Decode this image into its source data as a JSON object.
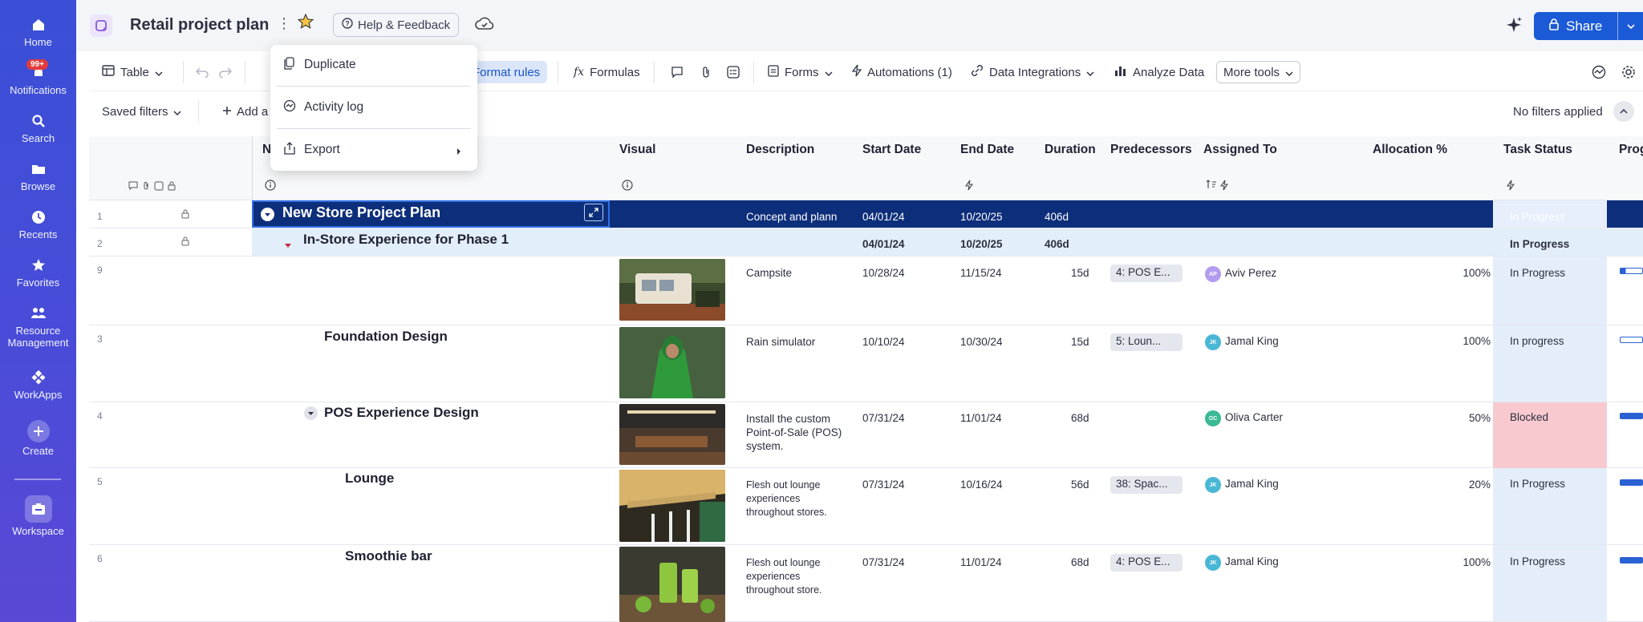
{
  "nav": {
    "items": [
      {
        "label": "Home",
        "icon": "home-icon"
      },
      {
        "label": "Notifications",
        "icon": "bell-icon",
        "badge": "99+"
      },
      {
        "label": "Search",
        "icon": "search-icon"
      },
      {
        "label": "Browse",
        "icon": "folder-icon"
      },
      {
        "label": "Recents",
        "icon": "clock-icon"
      },
      {
        "label": "Favorites",
        "icon": "star-icon"
      },
      {
        "label": "Resource Management",
        "icon": "people-icon"
      },
      {
        "label": "WorkApps",
        "icon": "workapps-icon"
      },
      {
        "label": "Create",
        "icon": "plus-icon"
      },
      {
        "label": "Workspace",
        "icon": "workspace-icon"
      }
    ]
  },
  "header": {
    "title": "Retail project plan",
    "help_label": "Help & Feedback",
    "share_label": "Share"
  },
  "toolbar": {
    "view_label": "Table",
    "format_rules": "Format rules",
    "formulas": "Formulas",
    "forms": "Forms",
    "automations": "Automations (1)",
    "data_integrations": "Data Integrations",
    "analyze_data": "Analyze Data",
    "more_tools": "More tools"
  },
  "filterbar": {
    "saved_filters": "Saved filters",
    "add_filter": "Add a",
    "status": "No filters applied"
  },
  "menu": {
    "items": [
      "Duplicate",
      "Activity log",
      "Export"
    ]
  },
  "columns": {
    "name": "N",
    "visual": "Visual",
    "description": "Description",
    "start_date": "Start Date",
    "end_date": "End Date",
    "duration": "Duration",
    "predecessors": "Predecessors",
    "assigned_to": "Assigned To",
    "allocation": "Allocation %",
    "task_status": "Task Status",
    "progress": "Prog"
  },
  "rows": [
    {
      "num": "1",
      "name": "New Store Project Plan",
      "description": "Concept and plann",
      "start": "04/01/24",
      "end": "10/20/25",
      "duration": "406d",
      "status": "In Progress"
    },
    {
      "num": "2",
      "name": "In-Store Experience for Phase 1",
      "start": "04/01/24",
      "end": "10/20/25",
      "duration": "406d",
      "status": "In Progress"
    },
    {
      "num": "9",
      "name": "",
      "description": "Campsite",
      "start": "10/28/24",
      "end": "11/15/24",
      "duration": "15d",
      "predecessors": "4: POS E...",
      "assigned": "Aviv Perez",
      "initials": "AP",
      "allocation": "100%",
      "status": "In Progress"
    },
    {
      "num": "3",
      "name": "Foundation Design",
      "description": "Rain simulator",
      "start": "10/10/24",
      "end": "10/30/24",
      "duration": "15d",
      "predecessors": "5: Loun...",
      "assigned": "Jamal King",
      "initials": "JK",
      "allocation": "100%",
      "status": "In progress"
    },
    {
      "num": "4",
      "name": "POS Experience Design",
      "description": "Install the custom Point-of-Sale (POS) system.",
      "start": "07/31/24",
      "end": "11/01/24",
      "duration": "68d",
      "assigned": "Oliva Carter",
      "initials": "OC",
      "allocation": "50%",
      "status": "Blocked"
    },
    {
      "num": "5",
      "name": "Lounge",
      "description": "Flesh out lounge experiences throughout stores.",
      "start": "07/31/24",
      "end": "10/16/24",
      "duration": "56d",
      "predecessors": "38: Spac...",
      "assigned": "Jamal King",
      "initials": "JK",
      "allocation": "20%",
      "status": "In Progress"
    },
    {
      "num": "6",
      "name": "Smoothie bar",
      "description": "Flesh out lounge experiences throughout store.",
      "start": "07/31/24",
      "end": "11/01/24",
      "duration": "68d",
      "predecessors": "4: POS E...",
      "assigned": "Jamal King",
      "initials": "JK",
      "allocation": "100%",
      "status": "In Progress"
    }
  ],
  "colors": {
    "nav_bg": "#4b4cd8",
    "share": "#1b5ad7",
    "selected_row": "#0d2e7a",
    "status_bg": "#e4eefb",
    "blocked_bg": "#f8c9cf"
  }
}
